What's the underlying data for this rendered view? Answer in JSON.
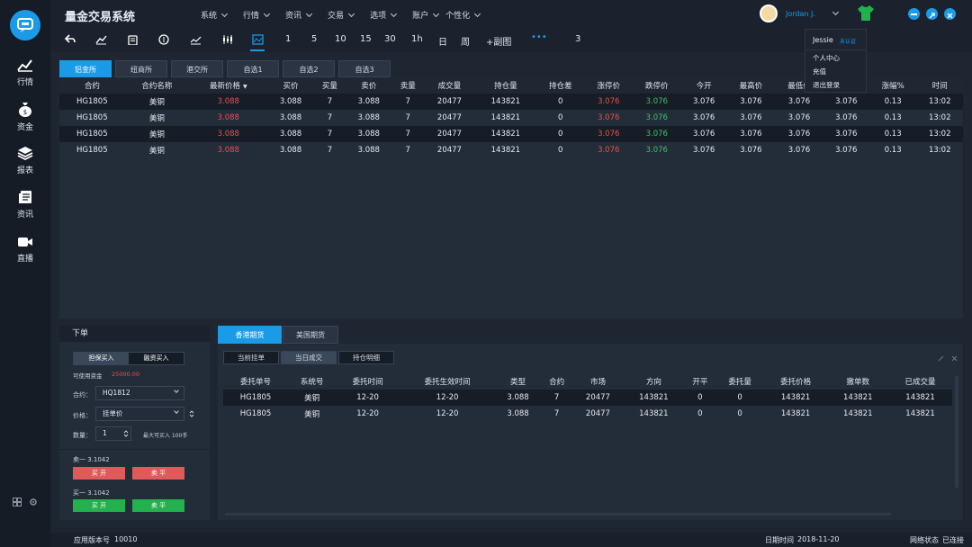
{
  "app": {
    "title": "量金交易系统"
  },
  "sidebar": {
    "items": [
      {
        "label": "行情"
      },
      {
        "label": "资金"
      },
      {
        "label": "报表"
      },
      {
        "label": "资讯"
      },
      {
        "label": "直播"
      }
    ]
  },
  "menus": [
    {
      "label": "系统"
    },
    {
      "label": "行情"
    },
    {
      "label": "资讯"
    },
    {
      "label": "交易"
    },
    {
      "label": "选项"
    },
    {
      "label": "账户"
    },
    {
      "label": "个性化"
    }
  ],
  "user": {
    "name": "Jordan J."
  },
  "dropdown": {
    "user": "Jessie",
    "verify": "未认证",
    "items": [
      {
        "label": "个人中心"
      },
      {
        "label": "充值"
      },
      {
        "label": "退出登录"
      }
    ]
  },
  "toolbar": {
    "periods": [
      {
        "label": "1"
      },
      {
        "label": "5"
      },
      {
        "label": "10"
      },
      {
        "label": "15"
      },
      {
        "label": "30"
      },
      {
        "label": "1h"
      },
      {
        "label": "日"
      },
      {
        "label": "周"
      },
      {
        "label": "+副图"
      }
    ],
    "more": "•••",
    "count": "3"
  },
  "market_tabs": [
    {
      "label": "铝金所"
    },
    {
      "label": "纽商所"
    },
    {
      "label": "港交所"
    },
    {
      "label": "自选1"
    },
    {
      "label": "自选2"
    },
    {
      "label": "自选3"
    }
  ],
  "quote_table": {
    "columns": [
      "合约",
      "合约名称",
      "最新价格",
      "买价",
      "买量",
      "卖价",
      "卖量",
      "成交量",
      "持仓量",
      "持仓差",
      "涨停价",
      "跌停价",
      "今开",
      "最高价",
      "最低价",
      "",
      "涨幅%",
      "时间"
    ],
    "sort_indicator": "▼",
    "rows": [
      [
        "HG1805",
        "美铜",
        "3.088",
        "3.088",
        "7",
        "3.088",
        "7",
        "20477",
        "143821",
        "0",
        "3.076",
        "3.076",
        "3.076",
        "3.076",
        "3.076",
        "3.076",
        "0.13",
        "13:02"
      ],
      [
        "HG1805",
        "美铜",
        "3.088",
        "3.088",
        "7",
        "3.088",
        "7",
        "20477",
        "143821",
        "0",
        "3.076",
        "3.076",
        "3.076",
        "3.076",
        "3.076",
        "3.076",
        "0.13",
        "13:02"
      ],
      [
        "HG1805",
        "美铜",
        "3.088",
        "3.088",
        "7",
        "3.088",
        "7",
        "20477",
        "143821",
        "0",
        "3.076",
        "3.076",
        "3.076",
        "3.076",
        "3.076",
        "3.076",
        "0.13",
        "13:02"
      ],
      [
        "HG1805",
        "美铜",
        "3.088",
        "3.088",
        "7",
        "3.088",
        "7",
        "20477",
        "143821",
        "0",
        "3.076",
        "3.076",
        "3.076",
        "3.076",
        "3.076",
        "3.076",
        "0.13",
        "13:02"
      ]
    ]
  },
  "order": {
    "title": "下单",
    "tabs": [
      {
        "label": "担保买入"
      },
      {
        "label": "融资买入"
      }
    ],
    "funds_label": "可使用资金",
    "funds_value": "25000.00",
    "contract_label": "合约：",
    "contract_value": "HQ1812",
    "price_label": "价格：",
    "price_value": "挂单价",
    "qty_label": "数量：",
    "qty_value": "1",
    "qty_max": "最大可买入 100手",
    "sell1": "卖一  3.1042",
    "buy1": "买一  3.1042",
    "btn_open": "买 开",
    "btn_close": "卖 平",
    "btn_open2": "买 开",
    "btn_close2": "卖 平"
  },
  "bottom_tabs": [
    {
      "label": "香港期货"
    },
    {
      "label": "美国期货"
    }
  ],
  "sub_tabs": [
    {
      "label": "当前挂单"
    },
    {
      "label": "当日成交"
    },
    {
      "label": "持仓明细"
    }
  ],
  "orders_table": {
    "columns": [
      "委托单号",
      "系统号",
      "委托时间",
      "委托生效时间",
      "类型",
      "合约",
      "市场",
      "方向",
      "开平",
      "委托量",
      "委托价格",
      "撤单数",
      "已成交量"
    ],
    "rows": [
      [
        "HG1805",
        "美铜",
        "12-20",
        "12-20",
        "3.088",
        "7",
        "20477",
        "143821",
        "0",
        "0",
        "143821",
        "143821",
        "143821"
      ],
      [
        "HG1805",
        "美铜",
        "12-20",
        "12-20",
        "3.088",
        "7",
        "20477",
        "143821",
        "0",
        "0",
        "143821",
        "143821",
        "143821"
      ]
    ]
  },
  "status": {
    "version_label": "应用版本号",
    "version": "10010",
    "date_label": "日期时间",
    "date": "2018-11-20",
    "net_label": "网络状态",
    "net": "已连接"
  },
  "colors": {
    "accent": "#1a9be8",
    "up": "#e9524a",
    "down": "#3ec26c",
    "green_btn": "#22b14c",
    "red_btn": "#e05a5a"
  }
}
